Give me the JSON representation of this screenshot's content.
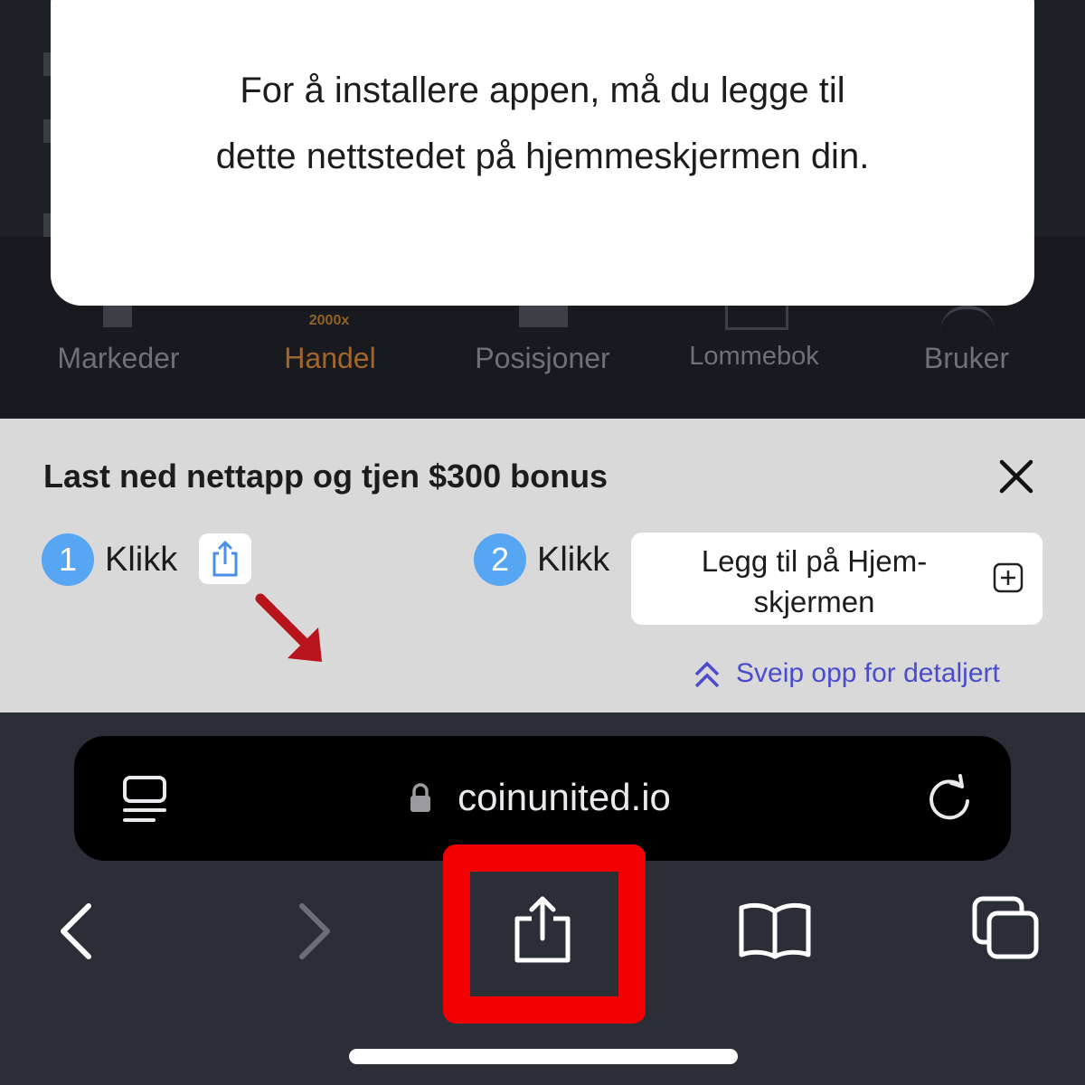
{
  "modal": {
    "line1": "For å installere appen, må du legge til",
    "line2": "dette nettstedet på hjemmeskjermen din."
  },
  "app_nav": {
    "items": [
      {
        "label": "Markeder",
        "active": false
      },
      {
        "label": "Handel",
        "active": true,
        "badge": "2000x"
      },
      {
        "label": "Posisjoner",
        "active": false
      },
      {
        "label": "Lommebok",
        "active": false
      },
      {
        "label": "Bruker",
        "active": false
      }
    ]
  },
  "banner": {
    "title": "Last ned nettapp og tjen $300 bonus",
    "step1": {
      "number": "1",
      "label": "Klikk"
    },
    "step2": {
      "number": "2",
      "label": "Klikk"
    },
    "add_home_line1": "Legg til på Hjem-",
    "add_home_line2": "skjermen",
    "swipe_hint": "Sveip opp for detaljert"
  },
  "browser": {
    "url": "coinunited.io"
  },
  "colors": {
    "accent_orange": "#a1672a",
    "step_blue": "#56a6f4",
    "hint_purple": "#4b4ccb",
    "highlight_red": "#f20000"
  }
}
